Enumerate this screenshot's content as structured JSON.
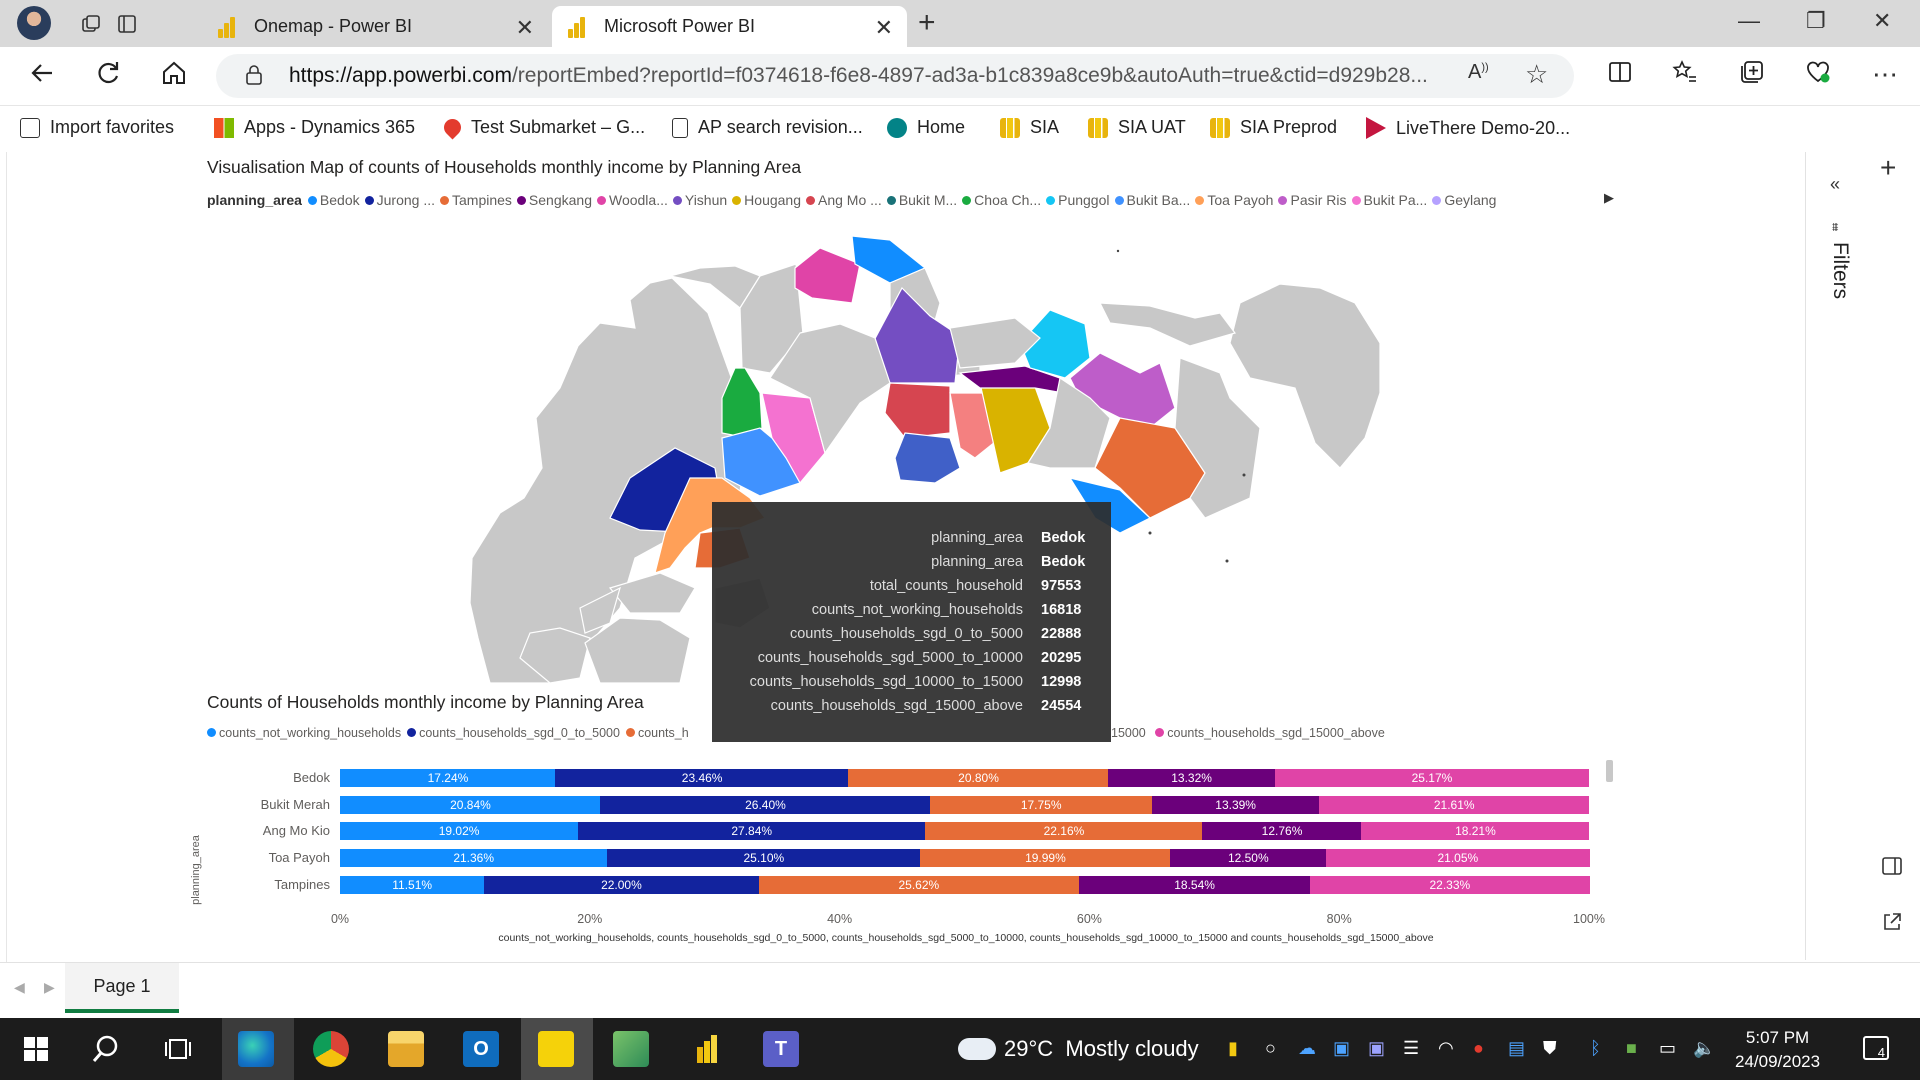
{
  "browser": {
    "tabs": [
      {
        "title": "Onemap - Power BI"
      },
      {
        "title": "Microsoft Power BI"
      }
    ],
    "url_domain": "https://app.powerbi.com",
    "url_path": "/reportEmbed?reportId=f0374618-f6e8-4897-ad3a-b1c839a8ce9b&autoAuth=true&ctid=d929b28...",
    "favorites": [
      "Import favorites",
      "Apps - Dynamics 365",
      "Test Submarket – G...",
      "AP search revision...",
      "Home",
      "SIA",
      "SIA UAT",
      "SIA Preprod",
      "LiveThere Demo-20..."
    ]
  },
  "map_visual": {
    "title": "Visualisation Map of counts of Households monthly income by Planning Area",
    "legend_title": "planning_area",
    "legend": [
      {
        "label": "Bedok",
        "color": "#118dff"
      },
      {
        "label": "Jurong ...",
        "color": "#12239e"
      },
      {
        "label": "Tampines",
        "color": "#e66c37"
      },
      {
        "label": "Sengkang",
        "color": "#6b007b"
      },
      {
        "label": "Woodla...",
        "color": "#e044a7"
      },
      {
        "label": "Yishun",
        "color": "#744ec2"
      },
      {
        "label": "Hougang",
        "color": "#d9b300"
      },
      {
        "label": "Ang Mo ...",
        "color": "#d64550"
      },
      {
        "label": "Bukit M...",
        "color": "#197278"
      },
      {
        "label": "Choa Ch...",
        "color": "#1aab40"
      },
      {
        "label": "Punggol",
        "color": "#15c6f4"
      },
      {
        "label": "Bukit Ba...",
        "color": "#4092ff"
      },
      {
        "label": "Toa Payoh",
        "color": "#ffa058"
      },
      {
        "label": "Pasir Ris",
        "color": "#be5dc9"
      },
      {
        "label": "Bukit Pa...",
        "color": "#f472d0"
      },
      {
        "label": "Geylang",
        "color": "#b5a1ff"
      }
    ]
  },
  "tooltip": {
    "rows": [
      {
        "key": "planning_area",
        "value": "Bedok"
      },
      {
        "key": "planning_area",
        "value": "Bedok"
      },
      {
        "key": "total_counts_household",
        "value": "97553"
      },
      {
        "key": "counts_not_working_households",
        "value": "16818"
      },
      {
        "key": "counts_households_sgd_0_to_5000",
        "value": "22888"
      },
      {
        "key": "counts_households_sgd_5000_to_10000",
        "value": "20295"
      },
      {
        "key": "counts_households_sgd_10000_to_15000",
        "value": "12998"
      },
      {
        "key": "counts_households_sgd_15000_above",
        "value": "24554"
      }
    ]
  },
  "bar_visual": {
    "title": "Counts of Households monthly income by Planning Area",
    "legend_visible": [
      {
        "label": "counts_not_working_households",
        "color": "#118dff"
      },
      {
        "label": "counts_households_sgd_0_to_5000",
        "color": "#12239e"
      },
      {
        "label": "counts_h",
        "color": "#e66c37"
      }
    ],
    "legend_partial_end": "15000",
    "legend_last": {
      "label": "counts_households_sgd_15000_above",
      "color": "#e044a7"
    }
  },
  "chart_data": {
    "type": "bar",
    "orientation": "horizontal",
    "stacked": "100%",
    "title": "Counts of Households monthly income by Planning Area",
    "ylabel": "planning_area",
    "xlabel": "counts_not_working_households, counts_households_sgd_0_to_5000, counts_households_sgd_5000_to_10000, counts_households_sgd_10000_to_15000 and counts_households_sgd_15000_above",
    "categories": [
      "Bedok",
      "Bukit Merah",
      "Ang Mo Kio",
      "Toa Payoh",
      "Tampines"
    ],
    "xticks": [
      "0%",
      "20%",
      "40%",
      "60%",
      "80%",
      "100%"
    ],
    "xlim": [
      0,
      100
    ],
    "series": [
      {
        "name": "counts_not_working_households",
        "color": "#118dff",
        "values": [
          17.24,
          20.84,
          19.02,
          21.36,
          11.51
        ]
      },
      {
        "name": "counts_households_sgd_0_to_5000",
        "color": "#12239e",
        "values": [
          23.46,
          26.4,
          27.84,
          25.1,
          22.0
        ]
      },
      {
        "name": "counts_households_sgd_5000_to_10000",
        "color": "#e66c37",
        "values": [
          20.8,
          17.75,
          22.16,
          19.99,
          25.62
        ]
      },
      {
        "name": "counts_households_sgd_10000_to_15000",
        "color": "#6b007b",
        "values": [
          13.32,
          13.39,
          12.76,
          12.5,
          18.54
        ]
      },
      {
        "name": "counts_households_sgd_15000_above",
        "color": "#e044a7",
        "values": [
          25.17,
          21.61,
          18.21,
          21.05,
          22.33
        ]
      }
    ]
  },
  "report": {
    "filters_label": "Filters",
    "page_tab": "Page 1"
  },
  "taskbar": {
    "weather_temp": "29°C",
    "weather_text": "Mostly cloudy",
    "time": "5:07 PM",
    "date": "24/09/2023",
    "notifications": "4"
  }
}
